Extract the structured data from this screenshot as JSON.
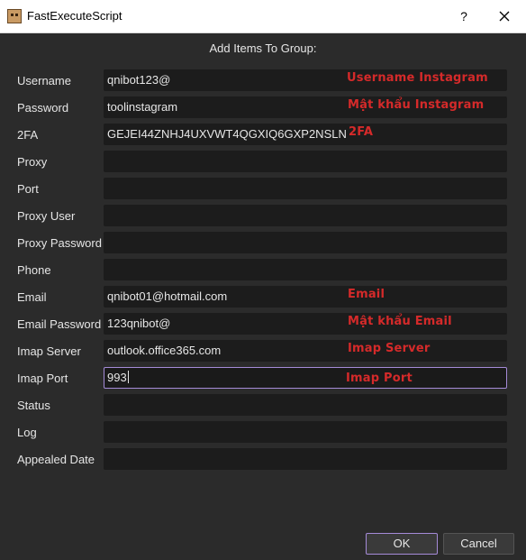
{
  "window": {
    "title": "FastExecuteScript",
    "help_label": "?"
  },
  "heading": "Add Items To Group:",
  "fields": [
    {
      "label": "Username",
      "value": "qnibot123@",
      "annotation": "Username Instagram"
    },
    {
      "label": "Password",
      "value": "toolinstagram",
      "annotation": "Mật khẩu Instagram"
    },
    {
      "label": "2FA",
      "value": "GEJEI44ZNHJ4UXVWT4QGXIQ6GXP2NSLN",
      "annotation": "2FA"
    },
    {
      "label": "Proxy",
      "value": "",
      "annotation": ""
    },
    {
      "label": "Port",
      "value": "",
      "annotation": ""
    },
    {
      "label": "Proxy User",
      "value": "",
      "annotation": ""
    },
    {
      "label": "Proxy Password",
      "value": "",
      "annotation": ""
    },
    {
      "label": "Phone",
      "value": "",
      "annotation": ""
    },
    {
      "label": "Email",
      "value": "qnibot01@hotmail.com",
      "annotation": "Email"
    },
    {
      "label": "Email Password",
      "value": "123qnibot@",
      "annotation": "Mật khẩu Email"
    },
    {
      "label": "Imap Server",
      "value": "outlook.office365.com",
      "annotation": "Imap Server"
    },
    {
      "label": "Imap Port",
      "value": "993",
      "annotation": "Imap Port"
    },
    {
      "label": "Status",
      "value": "",
      "annotation": ""
    },
    {
      "label": "Log",
      "value": "",
      "annotation": ""
    },
    {
      "label": "Appealed Date",
      "value": "",
      "annotation": ""
    }
  ],
  "buttons": {
    "ok": "OK",
    "cancel": "Cancel"
  },
  "colors": {
    "background": "#2b2b2b",
    "field_background": "#1c1c1c",
    "annotation": "#d52a2a",
    "focus_accent": "#a58bd8"
  },
  "icons": {
    "app": "app-icon",
    "close": "close-icon"
  }
}
